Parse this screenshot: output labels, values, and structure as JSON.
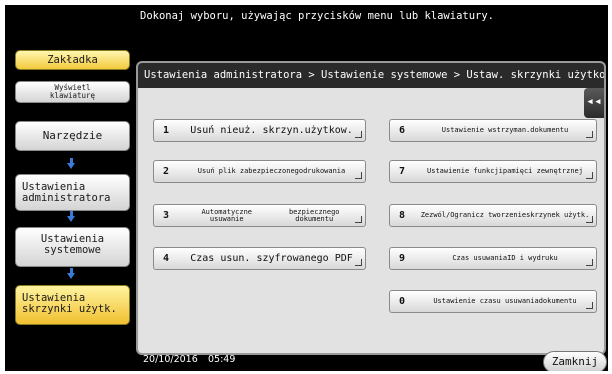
{
  "header": {
    "message": "Dokonaj wyboru, używając przycisków menu lub klawiatury."
  },
  "left": {
    "bookmark": "Zakładka",
    "keyboard_line1": "Wyświetl",
    "keyboard_line2": "klawiaturę",
    "nav": [
      {
        "l1": "Narzędzie",
        "l2": ""
      },
      {
        "l1": "Ustawienia",
        "l2": "administratora"
      },
      {
        "l1": "Ustawienia",
        "l2": "systemowe"
      },
      {
        "l1": "Ustawienia",
        "l2": "skrzynki użytk."
      }
    ]
  },
  "panel": {
    "breadcrumb": "Ustawienia administratora  > Ustawienie systemowe > Ustaw. skrzynki użytkow",
    "collapse": "◂◂",
    "items": [
      {
        "num": "1",
        "l1": "Usuń nieuż. skrzyn.użytkow.",
        "l2": ""
      },
      {
        "num": "2",
        "l1": "Usuń plik zabezpieczonego",
        "l2": "drukowania"
      },
      {
        "num": "3",
        "l1": "Automatyczne usuwanie",
        "l2": "bezpiecznego dokumentu"
      },
      {
        "num": "4",
        "l1": "Czas usun. szyfrowanego PDF",
        "l2": ""
      },
      {
        "num": "6",
        "l1": "Ustawienie wstrzyman.",
        "l2": "dokumentu"
      },
      {
        "num": "7",
        "l1": "Ustawienie funkcji",
        "l2": "pamięci zewnętrznej"
      },
      {
        "num": "8",
        "l1": "Zezwól/Ogranicz tworzenie",
        "l2": "skrzynek użytk."
      },
      {
        "num": "9",
        "l1": "Czas usuwania",
        "l2": "ID i wydruku"
      },
      {
        "num": "0",
        "l1": "Ustawienie czasu usuwania",
        "l2": "dokumentu"
      }
    ]
  },
  "footer": {
    "date": "20/10/2016",
    "time": "05:49",
    "close": "Zamknij"
  }
}
